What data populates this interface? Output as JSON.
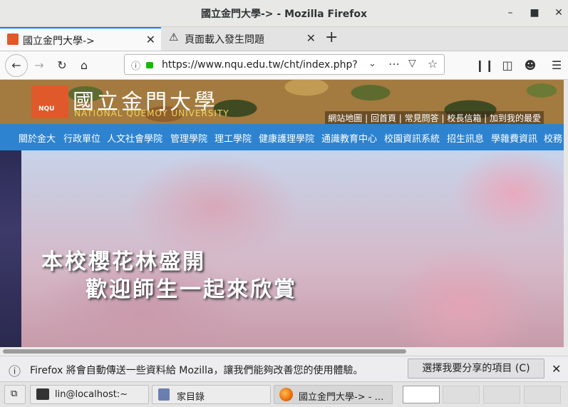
{
  "window": {
    "title": "國立金門大學-> - Mozilla Firefox"
  },
  "tabs": [
    {
      "label": "國立金門大學->",
      "active": true
    },
    {
      "label": "頁面載入發生問題",
      "active": false
    }
  ],
  "toolbar": {
    "url": "https://www.nqu.edu.tw/cht/index.php?",
    "new_tab": "+"
  },
  "site": {
    "logo_title": "國立金門大學",
    "logo_sub": "NATIONAL QUEMOY UNIVERSITY",
    "logo_badge": "NQU",
    "quick_links": "網站地圖 | 回首頁 | 常見問答 | 校長信箱 | 加到我的最愛",
    "menu": [
      "關於金大",
      "行政單位",
      "人文社會學院",
      "管理學院",
      "理工學院",
      "健康護理學院",
      "通識教育中心",
      "校園資訊系統",
      "招生訊息",
      "學雜費資訊",
      "校務"
    ],
    "hero_caption": "本校櫻花林盛開",
    "hero_caption2": "歡迎師生一起來欣賞"
  },
  "notification": {
    "text": "Firefox 將會自動傳送一些資料給 Mozilla，讓我們能夠改善您的使用體驗。",
    "button": "選擇我要分享的項目 (C)"
  },
  "taskbar": {
    "items": [
      {
        "label": "lin@localhost:~"
      },
      {
        "label": "家目錄"
      },
      {
        "label": "國立金門大學-> - …"
      }
    ]
  },
  "colors": {
    "accent": "#0a84ff",
    "menu_blue": "#2d83cf",
    "logo_orange": "#e0592a"
  }
}
